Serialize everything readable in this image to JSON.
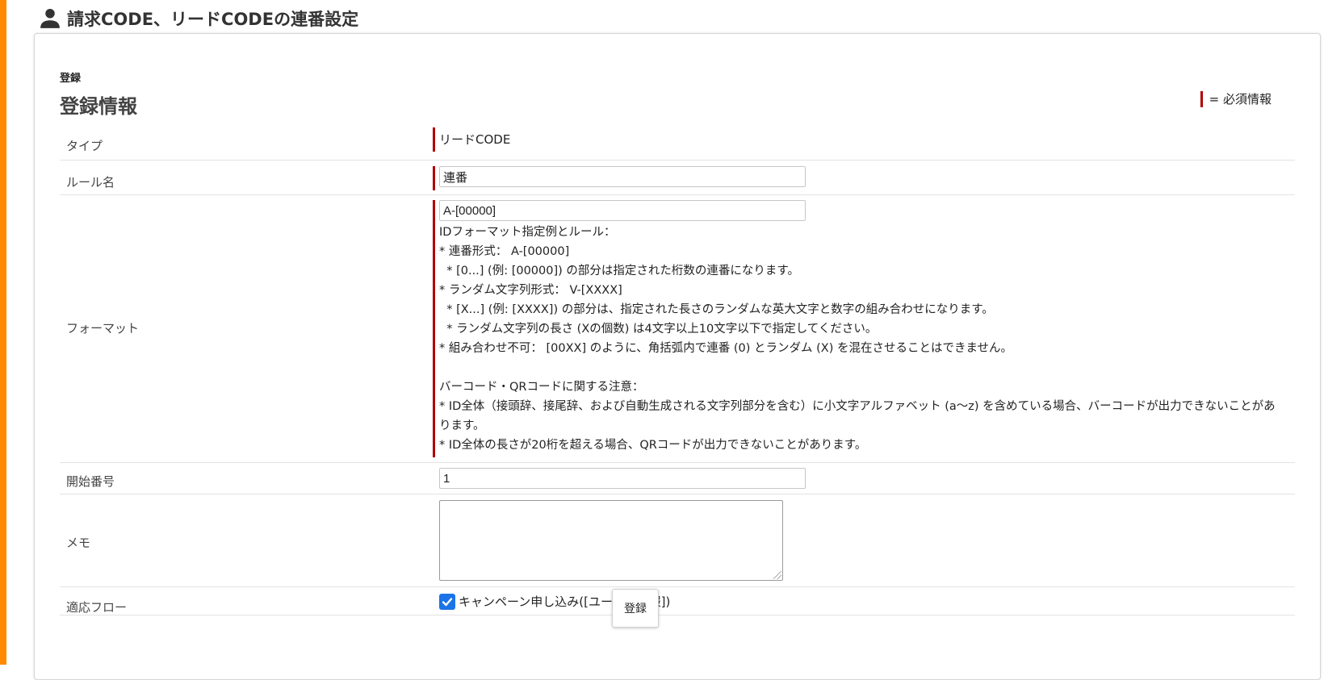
{
  "header": {
    "title": "請求CODE、リードCODEの連番設定",
    "icon": "user-icon"
  },
  "card": {
    "small_label": "登録",
    "section_title": "登録情報",
    "required_legend": "= 必須情報"
  },
  "form": {
    "type": {
      "label": "タイプ",
      "value": "リードCODE"
    },
    "rule_name": {
      "label": "ルール名",
      "value": "連番"
    },
    "format": {
      "label": "フォーマット",
      "value": "A-[00000]",
      "help": [
        "IDフォーマット指定例とルール：",
        "* 連番形式： A-[00000]",
        "  * [0...] (例: [00000]) の部分は指定された桁数の連番になります。",
        "* ランダム文字列形式： V-[XXXX]",
        "  * [X...] (例: [XXXX]) の部分は、指定された長さのランダムな英大文字と数字の組み合わせになります。",
        "  * ランダム文字列の長さ (Xの個数) は4文字以上10文字以下で指定してください。",
        "* 組み合わせ不可： [00XX] のように、角括弧内で連番 (0) とランダム (X) を混在させることはできません。",
        "",
        "バーコード・QRコードに関する注意：",
        "* ID全体（接頭辞、接尾辞、および自動生成される文字列部分を含む）に小文字アルファベット (a〜z) を含めている場合、バーコードが出力できないことがあります。",
        "* ID全体の長さが20桁を超える場合、QRコードが出力できないことがあります。"
      ]
    },
    "start_number": {
      "label": "開始番号",
      "value": "1"
    },
    "memo": {
      "label": "メモ",
      "value": ""
    },
    "flow": {
      "label": "適応フロー",
      "option": "キャンペーン申し込み([ユーザー情報])",
      "checked": true
    }
  },
  "submit_label": "登録",
  "colors": {
    "accent": "#ff8a00",
    "required": "#b00000",
    "checkbox": "#1a73e8"
  }
}
